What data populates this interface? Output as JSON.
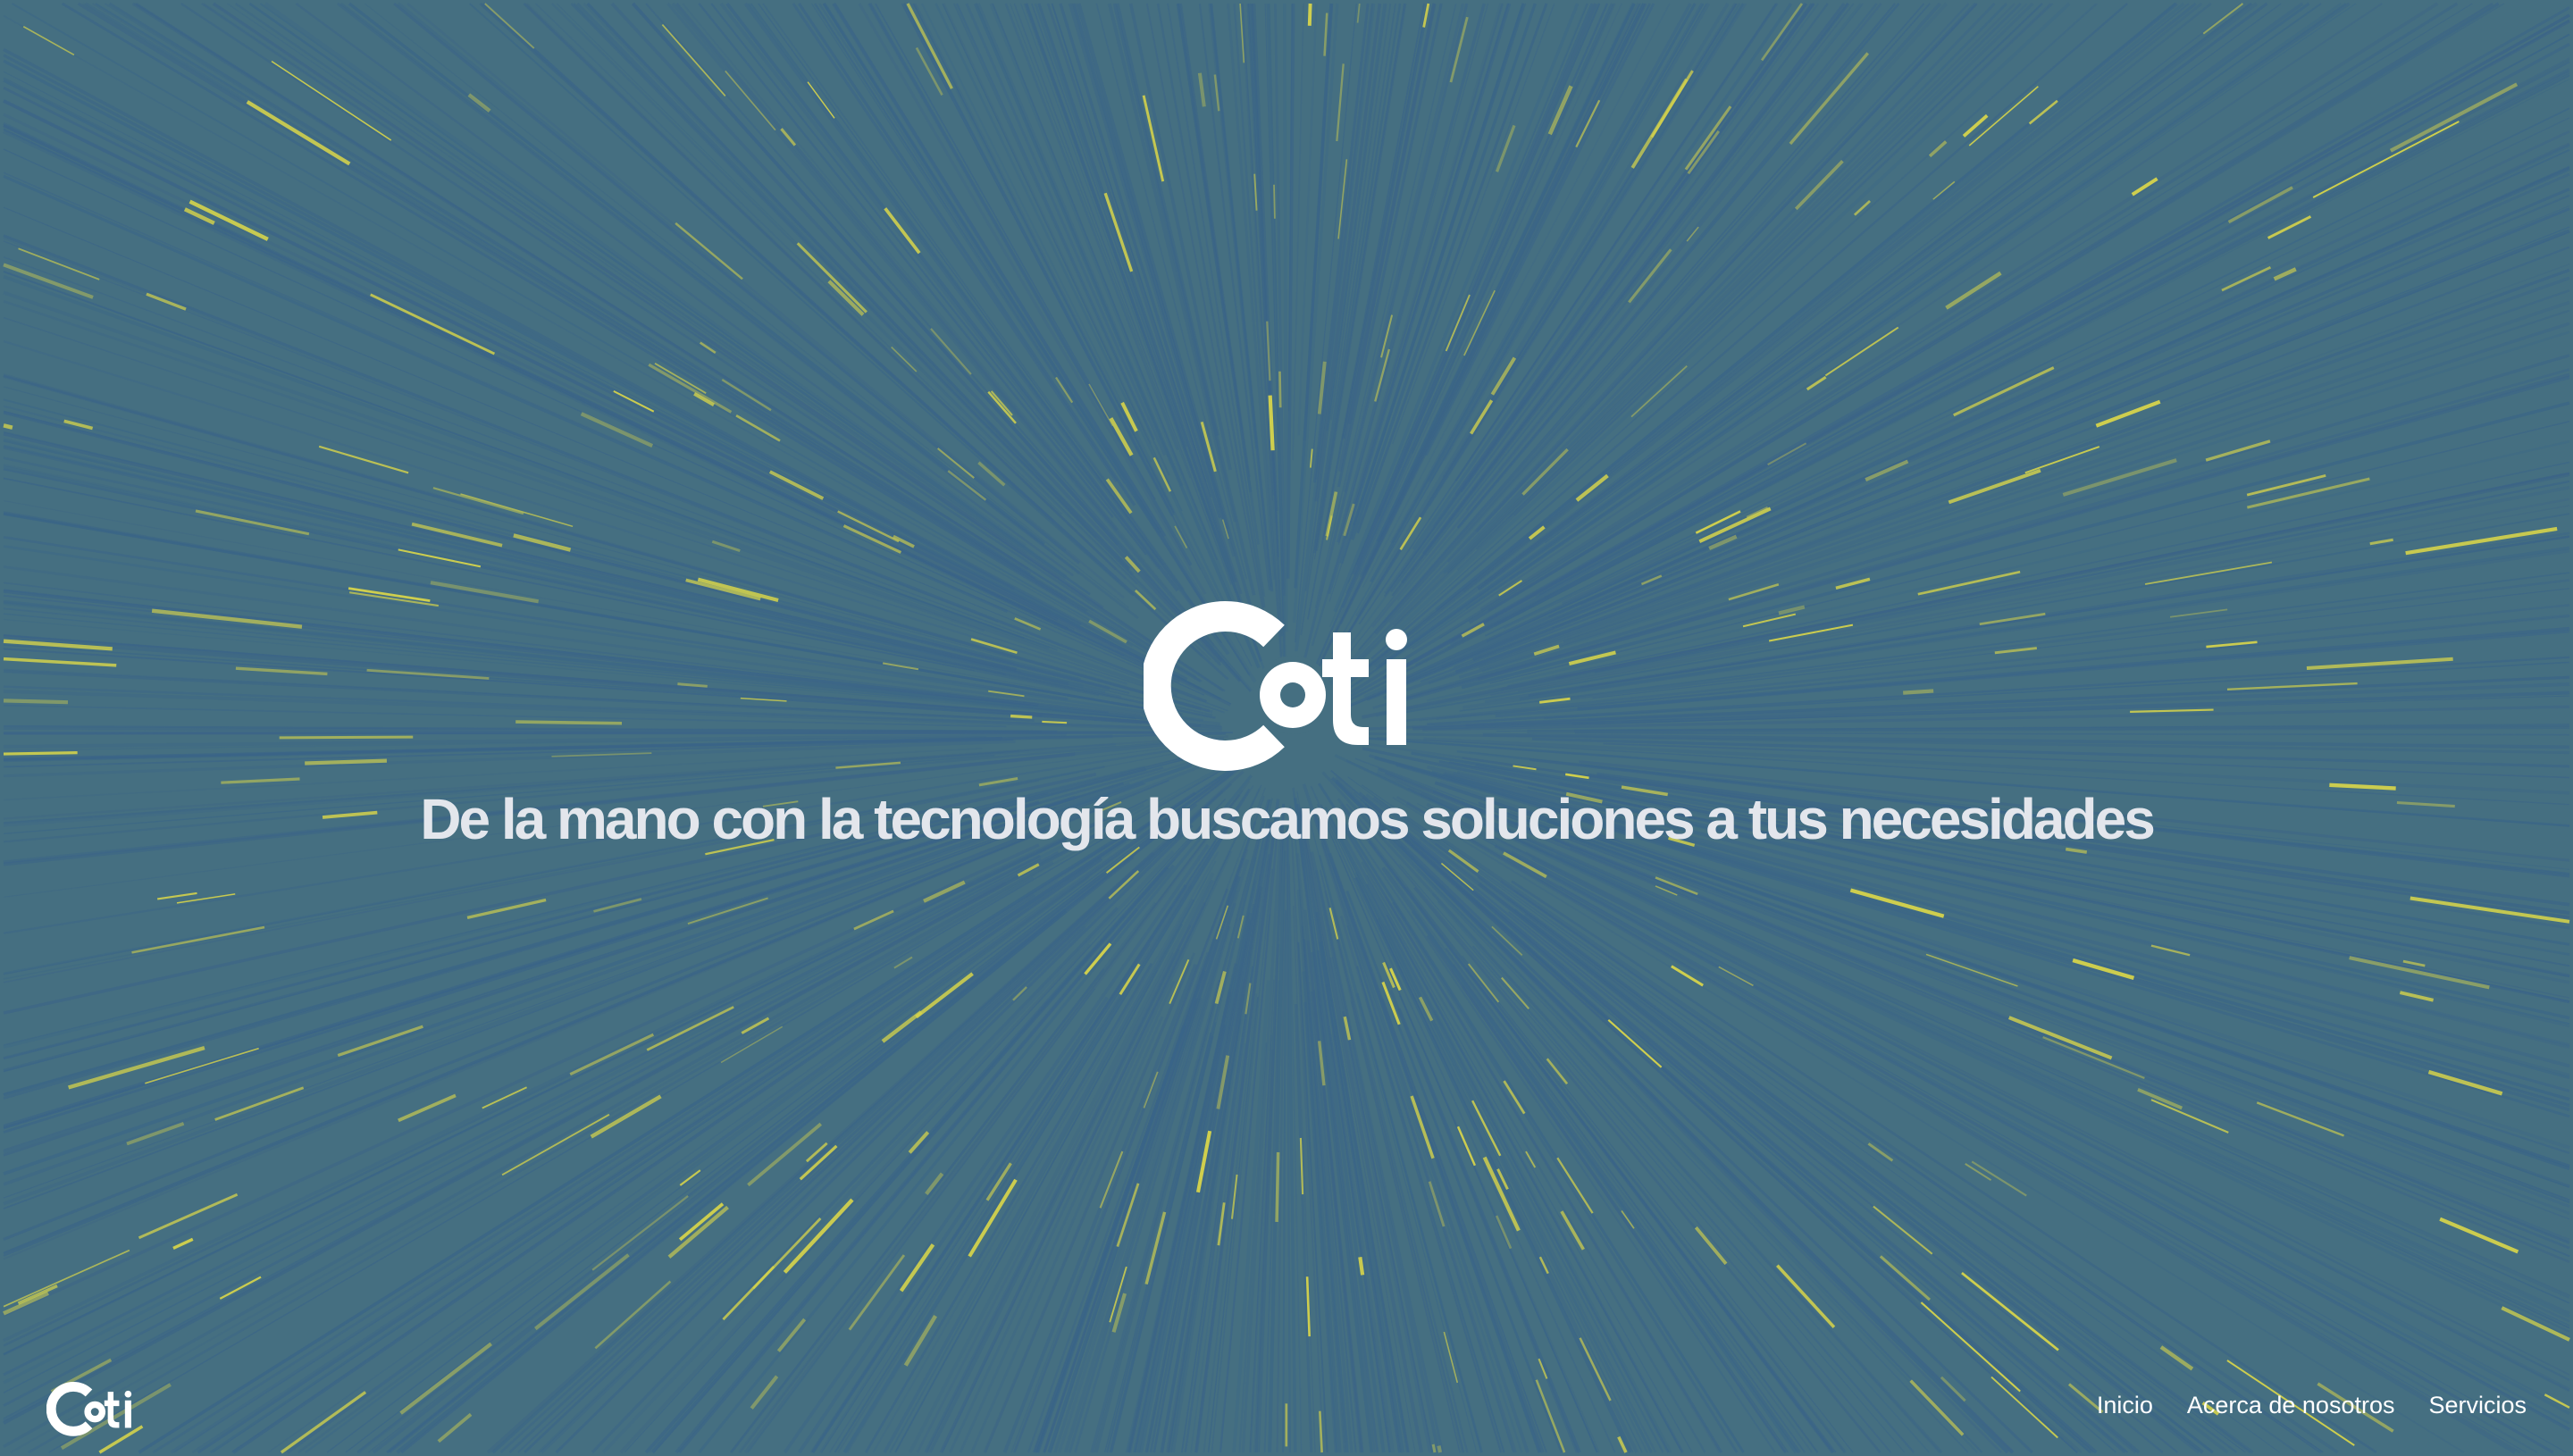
{
  "brand": {
    "logo_text": "Coti"
  },
  "hero": {
    "tagline": "De la mano con la tecnología buscamos soluciones a tus necesidades"
  },
  "nav": {
    "items": [
      {
        "label": "Inicio"
      },
      {
        "label": "Acerca de nosotros"
      },
      {
        "label": "Servicios"
      }
    ]
  },
  "colors": {
    "background": "#456f81",
    "ray_blue": "#3a6488",
    "ray_yellow": "#d8d54a",
    "text": "#e3e6ec"
  }
}
